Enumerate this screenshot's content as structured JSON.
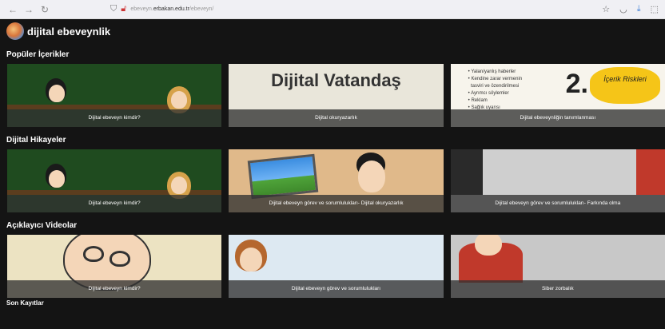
{
  "browser": {
    "url_prefix": "ebeveyn.",
    "url_domain": "erbakan.edu.tr",
    "url_path": "/ebeveyn/"
  },
  "site": {
    "brand": "dijital ebeveynlik"
  },
  "sections": [
    {
      "title": "Popüler İçerikler",
      "cards": [
        {
          "caption": "Dijital ebeveyn kimdir?"
        },
        {
          "caption": "Dijital okuryazarlık",
          "overlay": "Dijital Vatandaş"
        },
        {
          "caption": "Dijital ebeveynliğin tanımlanması",
          "bullets": [
            "Yalan/yanlış haberler",
            "Kendine zarar vermenin",
            "tasviri ve özendirilmesi",
            "Ayrımcı söylemler",
            "Reklam",
            "Sağlık uyarısı"
          ],
          "badge_number": "2.",
          "badge_text": "İçerik Riskleri"
        }
      ]
    },
    {
      "title": "Dijital Hikayeler",
      "cards": [
        {
          "caption": "Dijital ebeveyn kimdir?"
        },
        {
          "caption": "Dijital ebeveyn görev ve sorumlulukları- Dijital okuryazarlık"
        },
        {
          "caption": "Dijital ebeveyn görev ve sorumlulukları- Farkında olma"
        }
      ]
    },
    {
      "title": "Açıklayıcı Videolar",
      "cards": [
        {
          "caption": "Dijital ebeveyn kimdir?"
        },
        {
          "caption": "Dijital ebeveyn görev ve sorumlulukları"
        },
        {
          "caption": "Siber zorbalık"
        }
      ]
    }
  ],
  "next_section_title": "Son Kayıtlar"
}
